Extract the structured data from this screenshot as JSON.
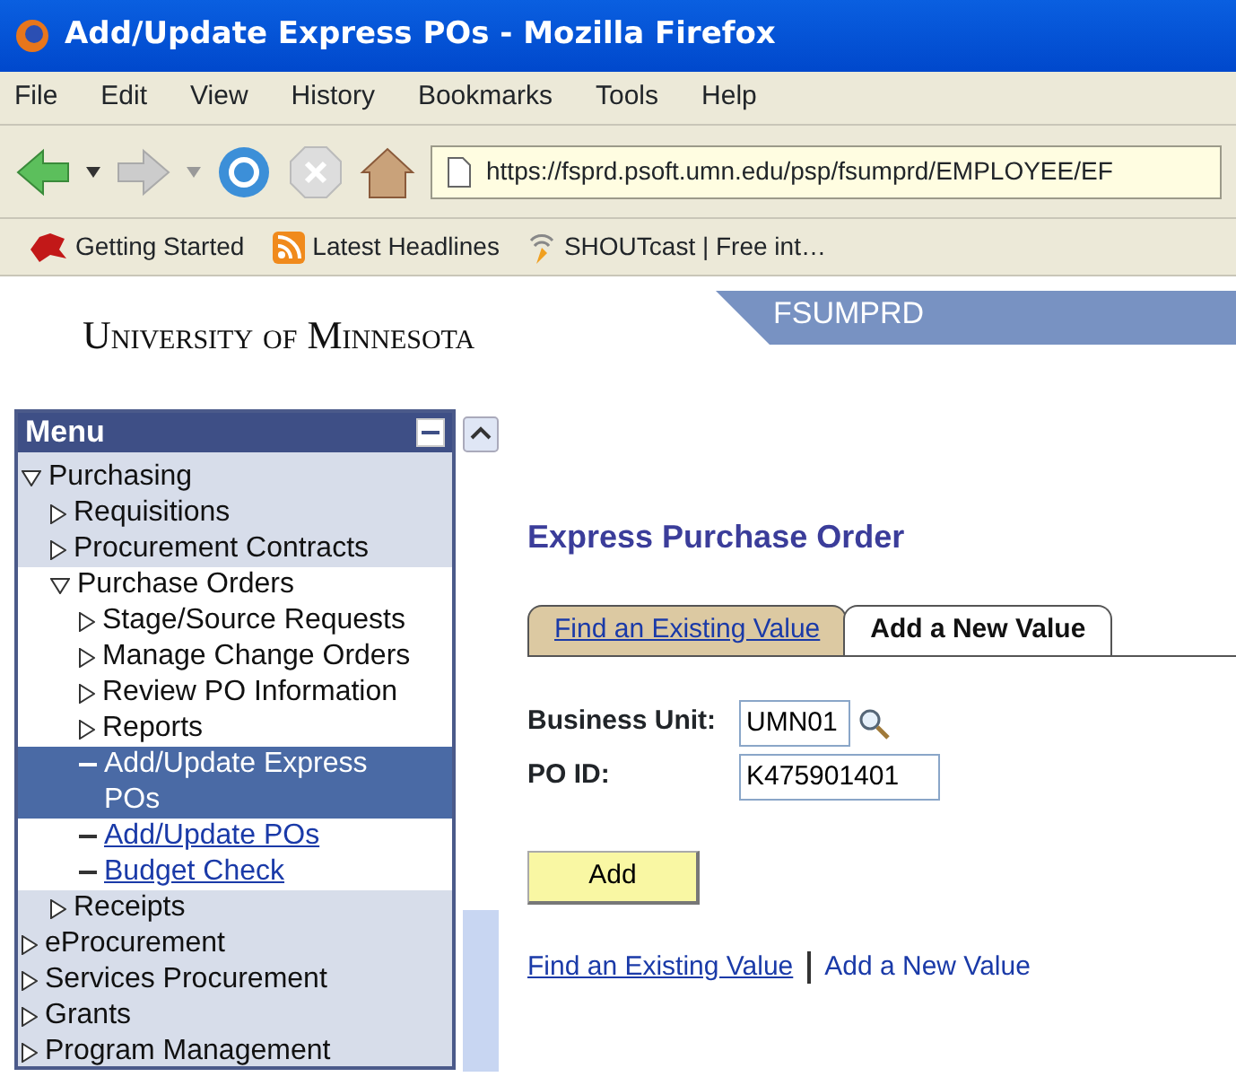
{
  "window": {
    "title": "Add/Update Express POs - Mozilla Firefox"
  },
  "menu_bar": [
    "File",
    "Edit",
    "View",
    "History",
    "Bookmarks",
    "Tools",
    "Help"
  ],
  "toolbar": {
    "address": "https://fsprd.psoft.umn.edu/psp/fsumprd/EMPLOYEE/EF"
  },
  "bookmarks": [
    "Getting Started",
    "Latest Headlines",
    "SHOUTcast | Free int…"
  ],
  "header": {
    "logo": "University of Minnesota",
    "database": "FSUMPRD"
  },
  "menu": {
    "title": "Menu",
    "items": [
      {
        "label": "Purchasing",
        "kind": "folder",
        "expanded": true,
        "children": [
          {
            "label": "Requisitions",
            "kind": "folder",
            "expanded": false
          },
          {
            "label": "Procurement Contracts",
            "kind": "folder",
            "expanded": false
          },
          {
            "label": "Purchase Orders",
            "kind": "folder",
            "expanded": true,
            "children": [
              {
                "label": "Stage/Source Requests",
                "kind": "folder",
                "expanded": false
              },
              {
                "label": "Manage Change Orders",
                "kind": "folder",
                "expanded": false
              },
              {
                "label": "Review PO Information",
                "kind": "folder",
                "expanded": false
              },
              {
                "label": "Reports",
                "kind": "folder",
                "expanded": false
              },
              {
                "label": "Add/Update Express POs",
                "kind": "leaf",
                "selected": true
              },
              {
                "label": "Add/Update POs",
                "kind": "leaf",
                "selected": false
              },
              {
                "label": "Budget Check",
                "kind": "leaf",
                "selected": false
              }
            ]
          },
          {
            "label": "Receipts",
            "kind": "folder",
            "expanded": false
          }
        ]
      },
      {
        "label": "eProcurement",
        "kind": "folder",
        "expanded": false
      },
      {
        "label": "Services Procurement",
        "kind": "folder",
        "expanded": false
      },
      {
        "label": "Grants",
        "kind": "folder",
        "expanded": false
      },
      {
        "label": "Program Management",
        "kind": "folder",
        "expanded": false
      }
    ]
  },
  "page": {
    "title": "Express Purchase Order",
    "tabs": [
      {
        "label": "Find an Existing Value",
        "selected": false
      },
      {
        "label": "Add a New Value",
        "selected": true
      }
    ],
    "fields": [
      {
        "label": "Business Unit:",
        "value": "UMN01",
        "lookup": true
      },
      {
        "label": "PO ID:",
        "value": "K475901401",
        "lookup": false
      }
    ],
    "button": "Add",
    "links": [
      {
        "label": "Find an Existing Value",
        "selected": false
      },
      {
        "label": "Add a New Value",
        "selected": true
      }
    ]
  }
}
